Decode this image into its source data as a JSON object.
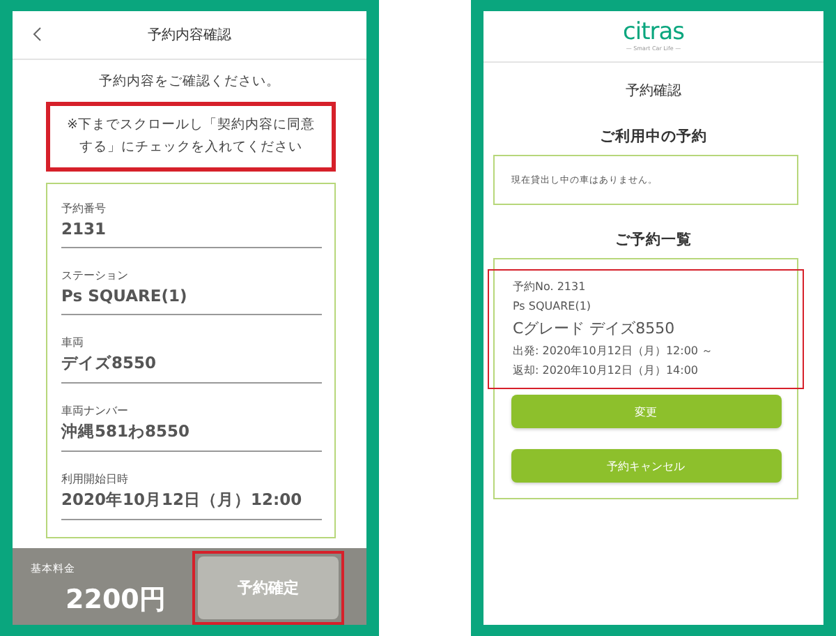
{
  "confirm_screen": {
    "header": {
      "title": "予約内容確認"
    },
    "subtitle": "予約内容をご確認ください。",
    "notice": {
      "text": "※下までスクロールし「契約内容に同意する」にチェックを入れてください",
      "highlighted": true
    },
    "fields": [
      {
        "label": "予約番号",
        "value": "2131"
      },
      {
        "label": "ステーション",
        "value": "Ps SQUARE(1)"
      },
      {
        "label": "車両",
        "value": "デイズ8550"
      },
      {
        "label": "車両ナンバー",
        "value": "沖縄581わ8550"
      },
      {
        "label": "利用開始日時",
        "value": "2020年10月12日（月）12:00"
      }
    ],
    "footer": {
      "price_label": "基本料金",
      "price": "2200円",
      "confirm_button": {
        "label": "予約確定",
        "disabled": true,
        "highlighted": true
      }
    }
  },
  "reservation_screen": {
    "logo": {
      "name": "citras",
      "tagline": "— Smart Car Life —"
    },
    "title": "予約確認",
    "current_section": {
      "heading": "ご利用中の予約",
      "message": "現在貸出し中の車はありません。"
    },
    "list_section": {
      "heading": "ご予約一覧",
      "reservations": [
        {
          "number": "予約No. 2131",
          "station": "Ps SQUARE(1)",
          "vehicle": "Cグレード デイズ8550",
          "departure": "出発: 2020年10月12日（月）12:00 ～",
          "return": "返却: 2020年10月12日（月）14:00",
          "highlighted": true,
          "buttons": [
            "変更",
            "予約キャンセル"
          ]
        }
      ]
    }
  }
}
